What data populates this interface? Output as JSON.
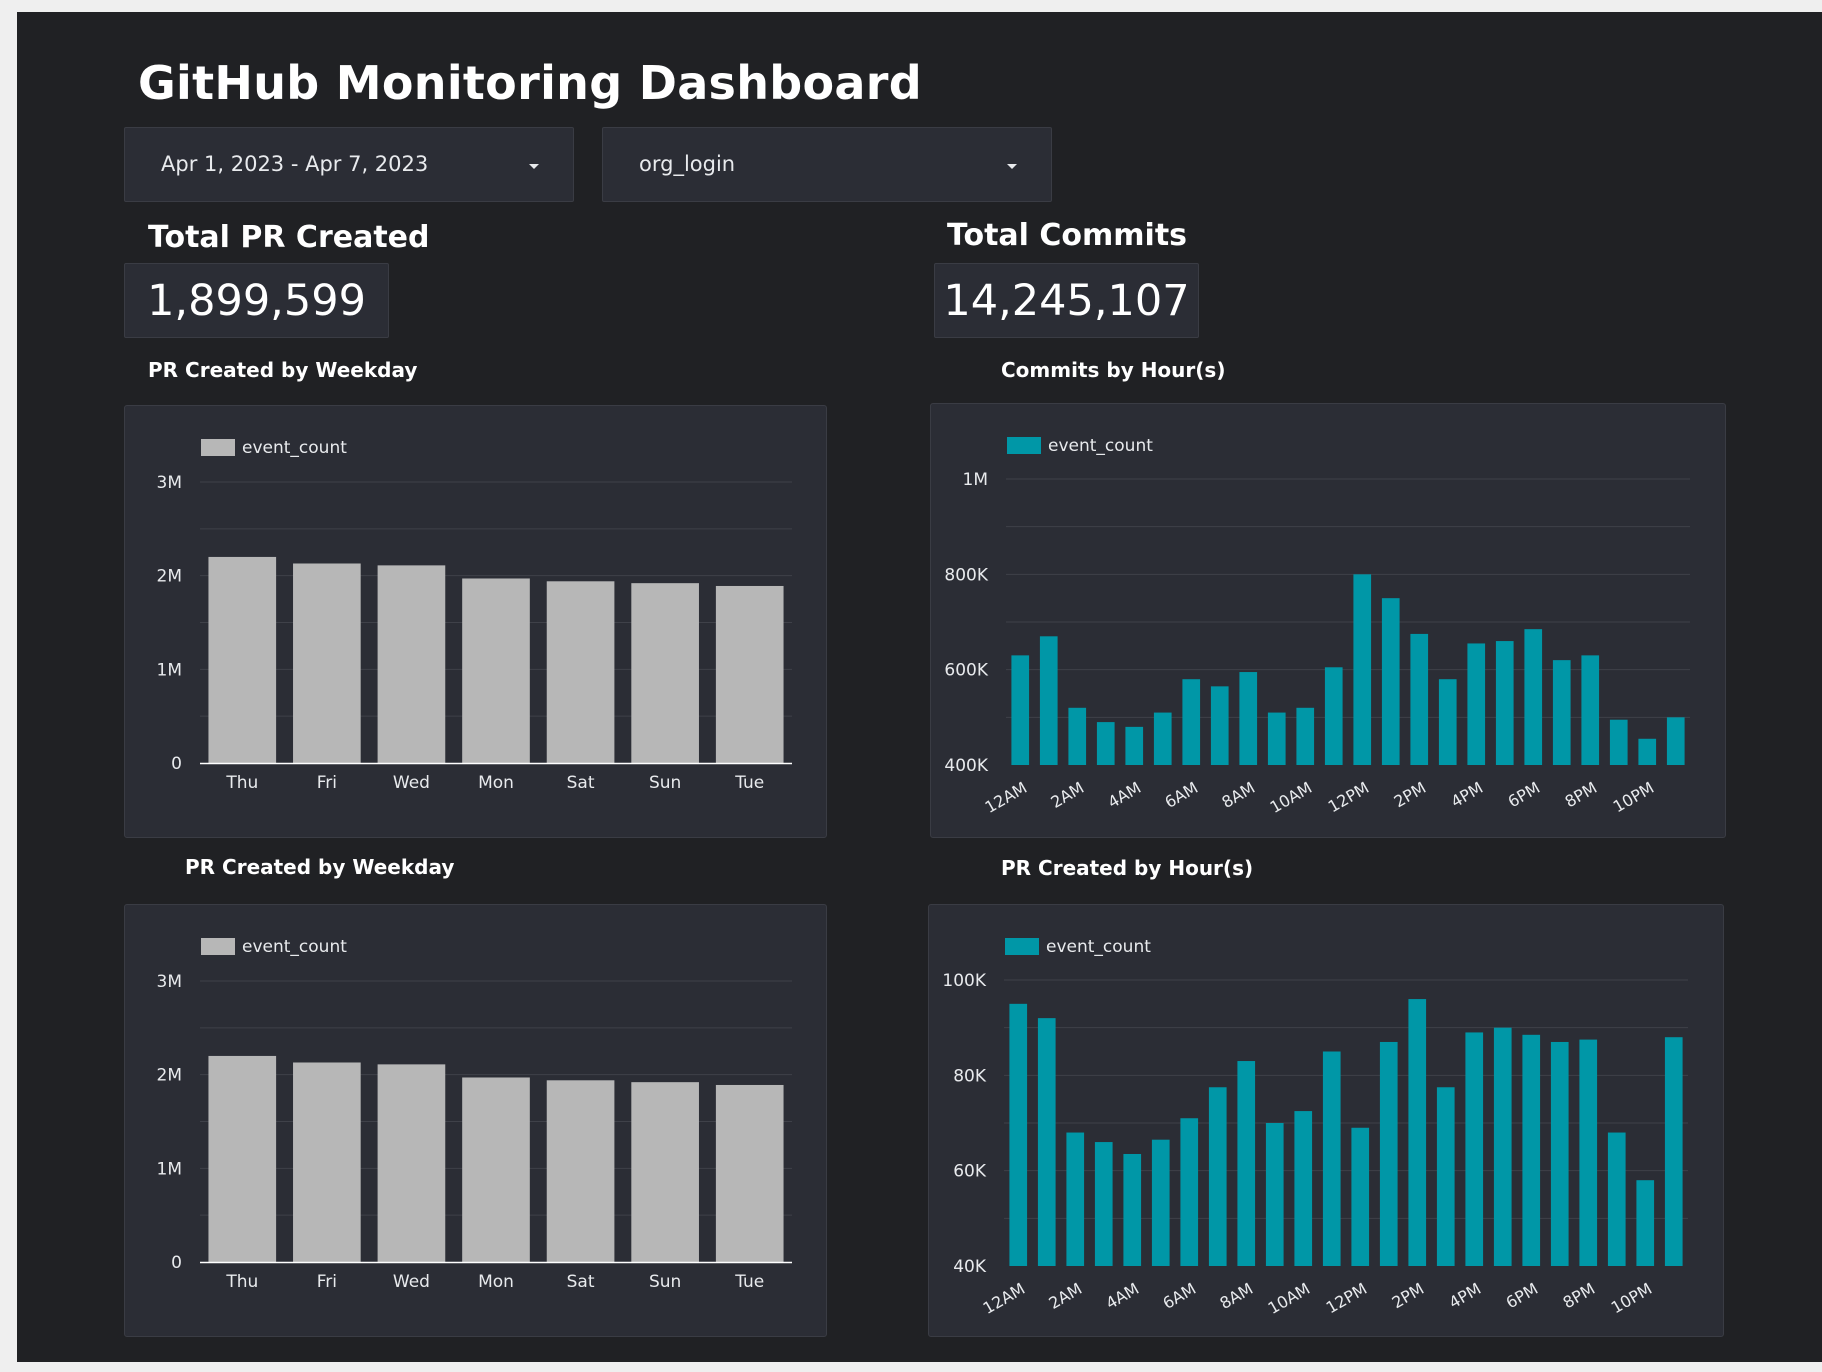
{
  "title": "GitHub Monitoring Dashboard",
  "controls": {
    "date_range": {
      "value": "Apr 1, 2023 - Apr 7, 2023",
      "icon": "caret-down-icon"
    },
    "org_filter": {
      "value": "org_login",
      "icon": "caret-down-icon"
    }
  },
  "kpis": {
    "total_pr": {
      "label": "Total PR Created",
      "value": "1,899,599"
    },
    "total_commits": {
      "label": "Total Commits",
      "value": "14,245,107"
    }
  },
  "colors": {
    "background": "#202124",
    "panel": "#2b2d35",
    "gray_bar": "#b7b7b7",
    "teal_bar": "#0097a7",
    "text": "#ffffff",
    "grid": "#3f4149"
  },
  "chart_data": [
    {
      "id": "pr_weekday_1",
      "title": "PR Created by Weekday",
      "type": "bar",
      "categories": [
        "Thu",
        "Fri",
        "Wed",
        "Mon",
        "Sat",
        "Sun",
        "Tue"
      ],
      "series": [
        {
          "name": "event_count",
          "values": [
            2200000,
            2130000,
            2110000,
            1970000,
            1940000,
            1920000,
            1890000
          ]
        }
      ],
      "ylim": [
        0,
        3000000
      ],
      "yticks": [
        0,
        1000000,
        2000000,
        3000000
      ],
      "ytick_labels": [
        "0",
        "1M",
        "2M",
        "3M"
      ],
      "grid": true,
      "legend": "top-left",
      "color": "#b7b7b7"
    },
    {
      "id": "commits_hour",
      "title": "Commits by Hour(s)",
      "type": "bar",
      "categories": [
        "12AM",
        "1AM",
        "2AM",
        "3AM",
        "4AM",
        "5AM",
        "6AM",
        "7AM",
        "8AM",
        "9AM",
        "10AM",
        "11AM",
        "12PM",
        "1PM",
        "2PM",
        "3PM",
        "4PM",
        "5PM",
        "6PM",
        "7PM",
        "8PM",
        "9PM",
        "10PM",
        "11PM"
      ],
      "xtick_labels": [
        "12AM",
        "",
        "2AM",
        "",
        "4AM",
        "",
        "6AM",
        "",
        "8AM",
        "",
        "10AM",
        "",
        "12PM",
        "",
        "2PM",
        "",
        "4PM",
        "",
        "6PM",
        "",
        "8PM",
        "",
        "10PM",
        ""
      ],
      "series": [
        {
          "name": "event_count",
          "values": [
            630000,
            670000,
            520000,
            490000,
            480000,
            510000,
            580000,
            565000,
            595000,
            510000,
            520000,
            605000,
            800000,
            750000,
            675000,
            580000,
            655000,
            660000,
            685000,
            620000,
            630000,
            495000,
            455000,
            500000
          ]
        }
      ],
      "ylim": [
        400000,
        1000000
      ],
      "yticks": [
        400000,
        600000,
        800000,
        1000000
      ],
      "ytick_labels": [
        "400K",
        "600K",
        "800K",
        "1M"
      ],
      "grid": true,
      "legend": "top-left",
      "color": "#0097a7"
    },
    {
      "id": "pr_weekday_2",
      "title": "PR Created by Weekday",
      "type": "bar",
      "categories": [
        "Thu",
        "Fri",
        "Wed",
        "Mon",
        "Sat",
        "Sun",
        "Tue"
      ],
      "series": [
        {
          "name": "event_count",
          "values": [
            2200000,
            2130000,
            2110000,
            1970000,
            1940000,
            1920000,
            1890000
          ]
        }
      ],
      "ylim": [
        0,
        3000000
      ],
      "yticks": [
        0,
        1000000,
        2000000,
        3000000
      ],
      "ytick_labels": [
        "0",
        "1M",
        "2M",
        "3M"
      ],
      "grid": true,
      "legend": "top-left",
      "color": "#b7b7b7"
    },
    {
      "id": "pr_hour",
      "title": "PR Created by Hour(s)",
      "type": "bar",
      "categories": [
        "12AM",
        "1AM",
        "2AM",
        "3AM",
        "4AM",
        "5AM",
        "6AM",
        "7AM",
        "8AM",
        "9AM",
        "10AM",
        "11AM",
        "12PM",
        "1PM",
        "2PM",
        "3PM",
        "4PM",
        "5PM",
        "6PM",
        "7PM",
        "8PM",
        "9PM",
        "10PM",
        "11PM"
      ],
      "xtick_labels": [
        "12AM",
        "",
        "2AM",
        "",
        "4AM",
        "",
        "6AM",
        "",
        "8AM",
        "",
        "10AM",
        "",
        "12PM",
        "",
        "2PM",
        "",
        "4PM",
        "",
        "6PM",
        "",
        "8PM",
        "",
        "10PM",
        ""
      ],
      "series": [
        {
          "name": "event_count",
          "values": [
            95000,
            92000,
            68000,
            66000,
            63500,
            66500,
            71000,
            77500,
            83000,
            70000,
            72500,
            85000,
            69000,
            87000,
            96000,
            77500,
            89000,
            90000,
            88500,
            87000,
            87500,
            68000,
            58000,
            88000
          ]
        }
      ],
      "ylim": [
        40000,
        100000
      ],
      "yticks": [
        40000,
        60000,
        80000,
        100000
      ],
      "ytick_labels": [
        "40K",
        "60K",
        "80K",
        "100K"
      ],
      "grid": true,
      "legend": "top-left",
      "color": "#0097a7"
    }
  ]
}
